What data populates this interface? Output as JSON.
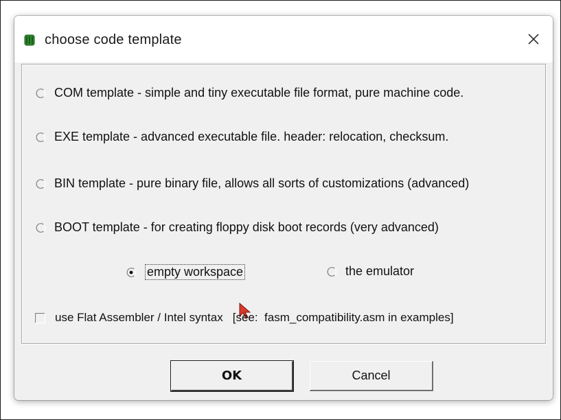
{
  "window": {
    "title": "choose code template",
    "icon": "green-chip-icon",
    "close_icon": "close-icon"
  },
  "templates": [
    {
      "label": "COM template - simple and tiny executable file format, pure machine code.",
      "selected": false
    },
    {
      "label": "EXE template - advanced executable file. header: relocation, checksum.",
      "selected": false
    },
    {
      "label": "BIN template - pure binary file, allows all sorts of customizations (advanced)",
      "selected": false
    },
    {
      "label": "BOOT template - for creating floppy disk boot records (very advanced)",
      "selected": false
    }
  ],
  "open_in": [
    {
      "label": "empty workspace",
      "selected": true
    },
    {
      "label": "the emulator",
      "selected": false
    }
  ],
  "fasm_option": {
    "label": "use Flat Assembler / Intel syntax",
    "hint": "[see:  fasm_compatibility.asm in examples]",
    "checked": false
  },
  "buttons": {
    "ok": "OK",
    "cancel": "Cancel"
  },
  "colors": {
    "icon_green": "#2e8b2e",
    "cursor_red": "#d93a2b"
  }
}
